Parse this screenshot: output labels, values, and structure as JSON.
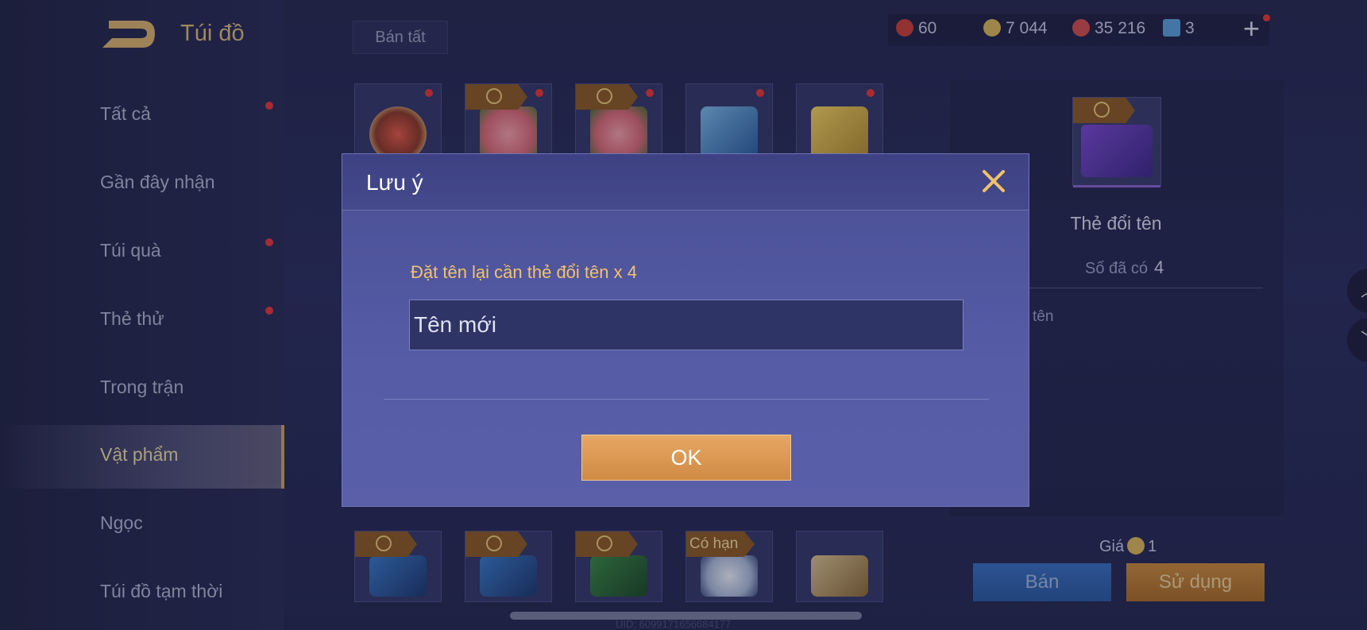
{
  "header": {
    "title": "Túi đồ",
    "sell_all": "Bán tất"
  },
  "currencies": [
    {
      "icon": "red-gem-icon",
      "value": "60",
      "color": "#c8423a"
    },
    {
      "icon": "gold-coin-icon",
      "value": "7 044",
      "color": "#d7b45a"
    },
    {
      "icon": "red-voucher-icon",
      "value": "35 216",
      "color": "#d05050"
    },
    {
      "icon": "blue-card-icon",
      "value": "3",
      "color": "#5a9fd8"
    }
  ],
  "sidebar": {
    "items": [
      {
        "label": "Tất cả",
        "dot": true
      },
      {
        "label": "Gần đây nhận",
        "dot": false
      },
      {
        "label": "Túi quà",
        "dot": true
      },
      {
        "label": "Thẻ thử",
        "dot": true
      },
      {
        "label": "Trong trận",
        "dot": false
      },
      {
        "label": "Vật phẩm",
        "dot": false,
        "active": true
      },
      {
        "label": "Ngọc",
        "dot": false
      },
      {
        "label": "Túi đồ tạm thời",
        "dot": false
      }
    ]
  },
  "grid": {
    "bottom_row_tag": "Có hạn"
  },
  "detail": {
    "name": "Thẻ đổi tên",
    "owned_label": "Số đã có",
    "owned_value": "4",
    "desc_fragment": "tên",
    "price_label": "Giá",
    "price_value": "1",
    "sell_label": "Bán",
    "use_label": "Sử dụng"
  },
  "uid": "UID: 6099171656684177",
  "modal": {
    "title": "Lưu ý",
    "prompt": "Đặt tên lại cần thẻ đổi tên x 4",
    "input_placeholder": "Tên mới",
    "ok_label": "OK"
  }
}
